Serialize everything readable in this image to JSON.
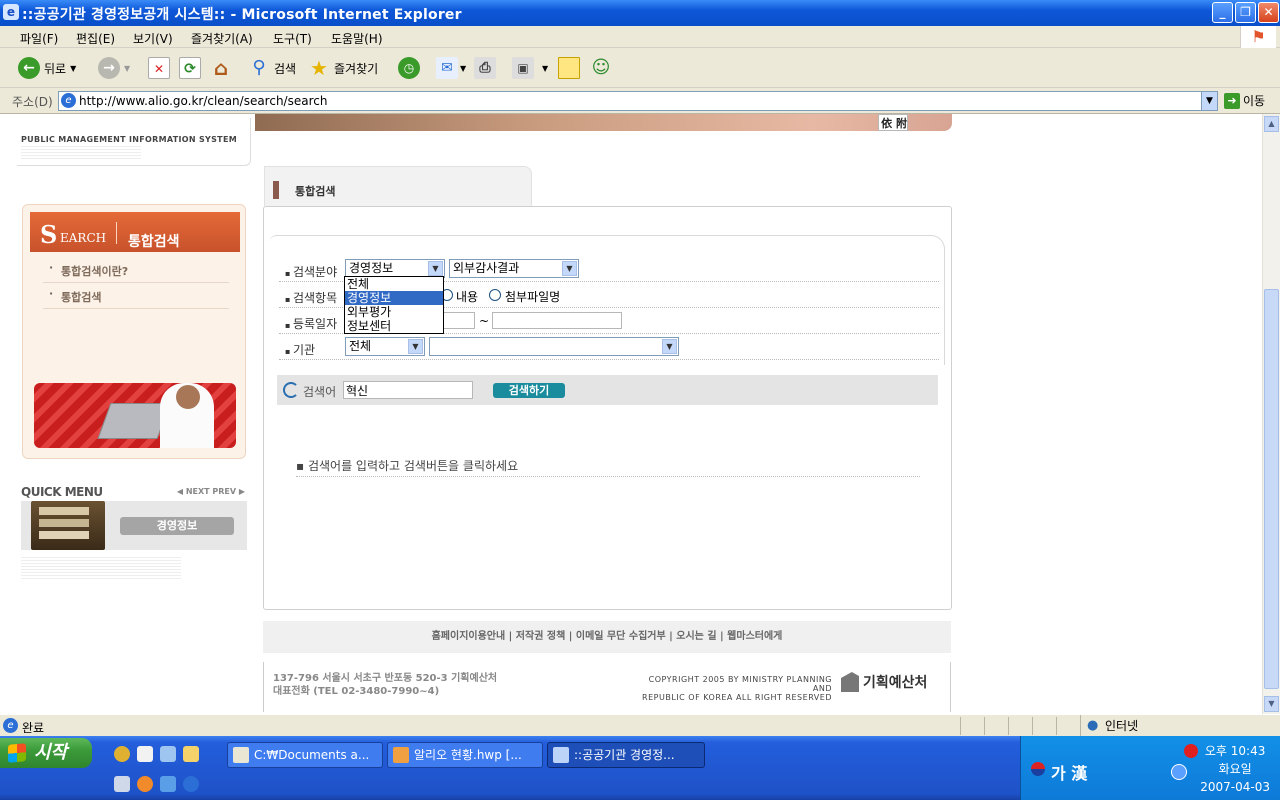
{
  "window": {
    "title": "::공공기관 경영정보공개 시스템:: - Microsoft Internet Explorer",
    "minimize": "_",
    "maximize": "❐",
    "close": "✕"
  },
  "menu": {
    "items": [
      "파일(F)",
      "편집(E)",
      "보기(V)",
      "즐겨찾기(A)",
      "도구(T)",
      "도움말(H)"
    ]
  },
  "toolbar": {
    "back": "뒤로",
    "search": "검색",
    "favorites": "즐겨찾기"
  },
  "address": {
    "label": "주소(D)",
    "url": "http://www.alio.go.kr/clean/search/search",
    "go": "이동"
  },
  "banner": {
    "text": "依 附"
  },
  "header": {
    "system_name": "PUBLIC MANAGEMENT INFORMATION SYSTEM"
  },
  "sidebar": {
    "head_big": "S",
    "head_small": "EARCH",
    "head_label": "통합검색",
    "links": [
      "통합검색이란?",
      "통합검색"
    ]
  },
  "quickmenu": {
    "title": "QUICK MENU",
    "nav": "◀ NEXT  PREV ▶",
    "button": "경영정보"
  },
  "tab": {
    "title": "통합검색"
  },
  "form": {
    "field_label": "검색분야",
    "field_value": "경영정보",
    "subfield_value": "외부감사결과",
    "item_label": "검색항목",
    "item_options": [
      "내용",
      "첨부파일명"
    ],
    "date_label": "등록일자",
    "date_sep": "~",
    "agency_label": "기관",
    "agency_value": "전체",
    "agency_sub_value": "",
    "dropdown_options": [
      "전체",
      "경영정보",
      "외부평가",
      "정보센터"
    ],
    "dropdown_selected": "경영정보"
  },
  "search": {
    "label": "검색어",
    "value": "혁신",
    "button": "검색하기"
  },
  "hint": "▪ 검색어를 입력하고 검색버튼을 클릭하세요",
  "footer": {
    "links": "홈페이지이용안내  |  저작권 정책  |  이메일 무단 수집거부  |  오시는 길  |  웹마스터에게",
    "address_line1": "137-796 서울시 서초구 반포동 520-3 기획예산처",
    "address_line2": "대표전화 (TEL 02-3480-7990~4)",
    "copyright_line1": "COPYRIGHT 2005 BY MINISTRY PLANNING AND",
    "copyright_line2": "REPUBLIC OF KOREA ALL RIGHT RESERVED",
    "ministry": "기획예산처"
  },
  "status": {
    "text": "완료",
    "zone": "인터넷"
  },
  "taskbar": {
    "start": "시작",
    "tasks": [
      "C:₩Documents a...",
      "알리오 현황.hwp [...",
      "::공공기관 경영정..."
    ],
    "ime": "가 漢",
    "time": "오후 10:43",
    "day": "화요일",
    "date": "2007-04-03"
  }
}
